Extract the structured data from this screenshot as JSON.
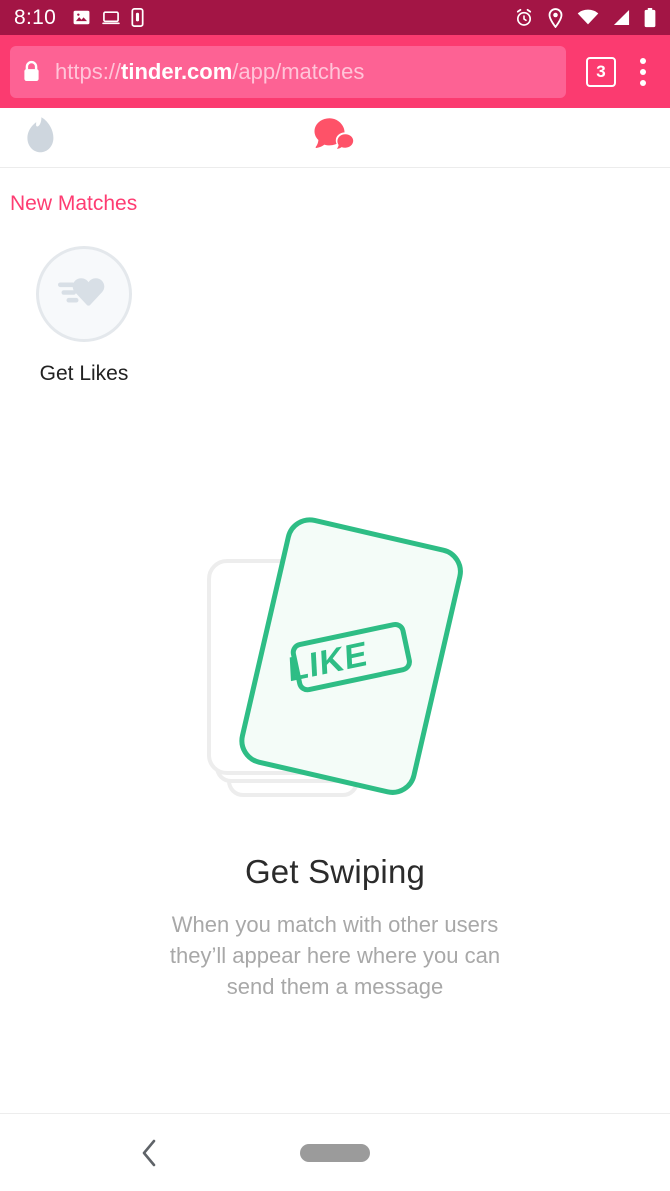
{
  "status_bar": {
    "clock": "8:10",
    "left_icons": [
      "screenshot-icon",
      "cast-laptop-icon",
      "sim-card-icon"
    ],
    "right_icons": [
      "alarm-icon",
      "location-icon",
      "wifi-icon",
      "cellular-signal-icon",
      "battery-icon"
    ],
    "background_color": "#a31545"
  },
  "browser": {
    "url_scheme": "https://",
    "url_host": "tinder.com",
    "url_path": "/app/matches",
    "url_full": "https://tinder.com/app/matches",
    "lock_icon": "lock-icon",
    "tab_count": "3",
    "menu_icon": "overflow-menu-icon",
    "background_color": "#fb3b70",
    "omnibox_color": "#fd6294"
  },
  "app": {
    "tabs": [
      {
        "name": "flame-tab",
        "label": "Discover",
        "active": false,
        "color": "#ced6de"
      },
      {
        "name": "messages-tab",
        "label": "Messages",
        "active": true,
        "color": "#fe5268"
      }
    ],
    "new_matches": {
      "heading": "New Matches",
      "heading_color": "#fe3c72",
      "get_likes_label": "Get Likes",
      "get_likes_icon": "flying-heart-icon"
    },
    "empty_state": {
      "illustration": "swipe-cards-like-illustration",
      "stamp_label": "LIKE",
      "accent_color": "#2ebd85",
      "title": "Get Swiping",
      "body_line_1": "When you match with other users",
      "body_line_2": "they’ll appear here where you can",
      "body_line_3": "send them a message",
      "body": "When you match with other users they’ll appear here where you can send them a message"
    }
  },
  "nav_bar": {
    "back_icon": "back-chevron-icon",
    "home_pill": "home-pill-indicator"
  }
}
